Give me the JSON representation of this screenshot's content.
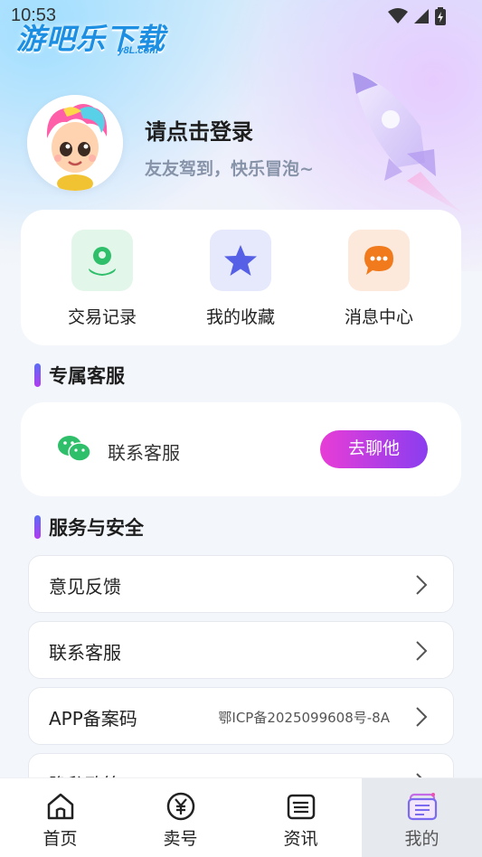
{
  "status_bar": {
    "time": "10:53"
  },
  "app": {
    "logo_text": "游吧乐下载",
    "logo_sub": "y8L.com"
  },
  "profile": {
    "title": "请点击登录",
    "subtitle": "友友驾到，快乐冒泡~"
  },
  "shortcuts": [
    {
      "label": "交易记录",
      "icon": "user-location-icon",
      "color": "#2fbf6a",
      "bg": "#e3f6ea"
    },
    {
      "label": "我的收藏",
      "icon": "star-icon",
      "color": "#5560e6",
      "bg": "#e6e8fb"
    },
    {
      "label": "消息中心",
      "icon": "chat-bubble-icon",
      "color": "#f07a1c",
      "bg": "#fde9dc"
    }
  ],
  "sections": {
    "exclusive_service": "专属客服",
    "service_security": "服务与安全"
  },
  "contact": {
    "label": "联系客服",
    "button": "去聊他"
  },
  "list": [
    {
      "label": "意见反馈",
      "value": ""
    },
    {
      "label": "联系客服",
      "value": ""
    },
    {
      "label": "APP备案码",
      "value": "鄂ICP备2025099608号-8A"
    },
    {
      "label": "隐私政策",
      "value": ""
    }
  ],
  "nav": [
    {
      "label": "首页",
      "icon": "home-icon"
    },
    {
      "label": "卖号",
      "icon": "yen-icon"
    },
    {
      "label": "资讯",
      "icon": "news-icon"
    },
    {
      "label": "我的",
      "icon": "profile-cards-icon",
      "active": true
    }
  ]
}
